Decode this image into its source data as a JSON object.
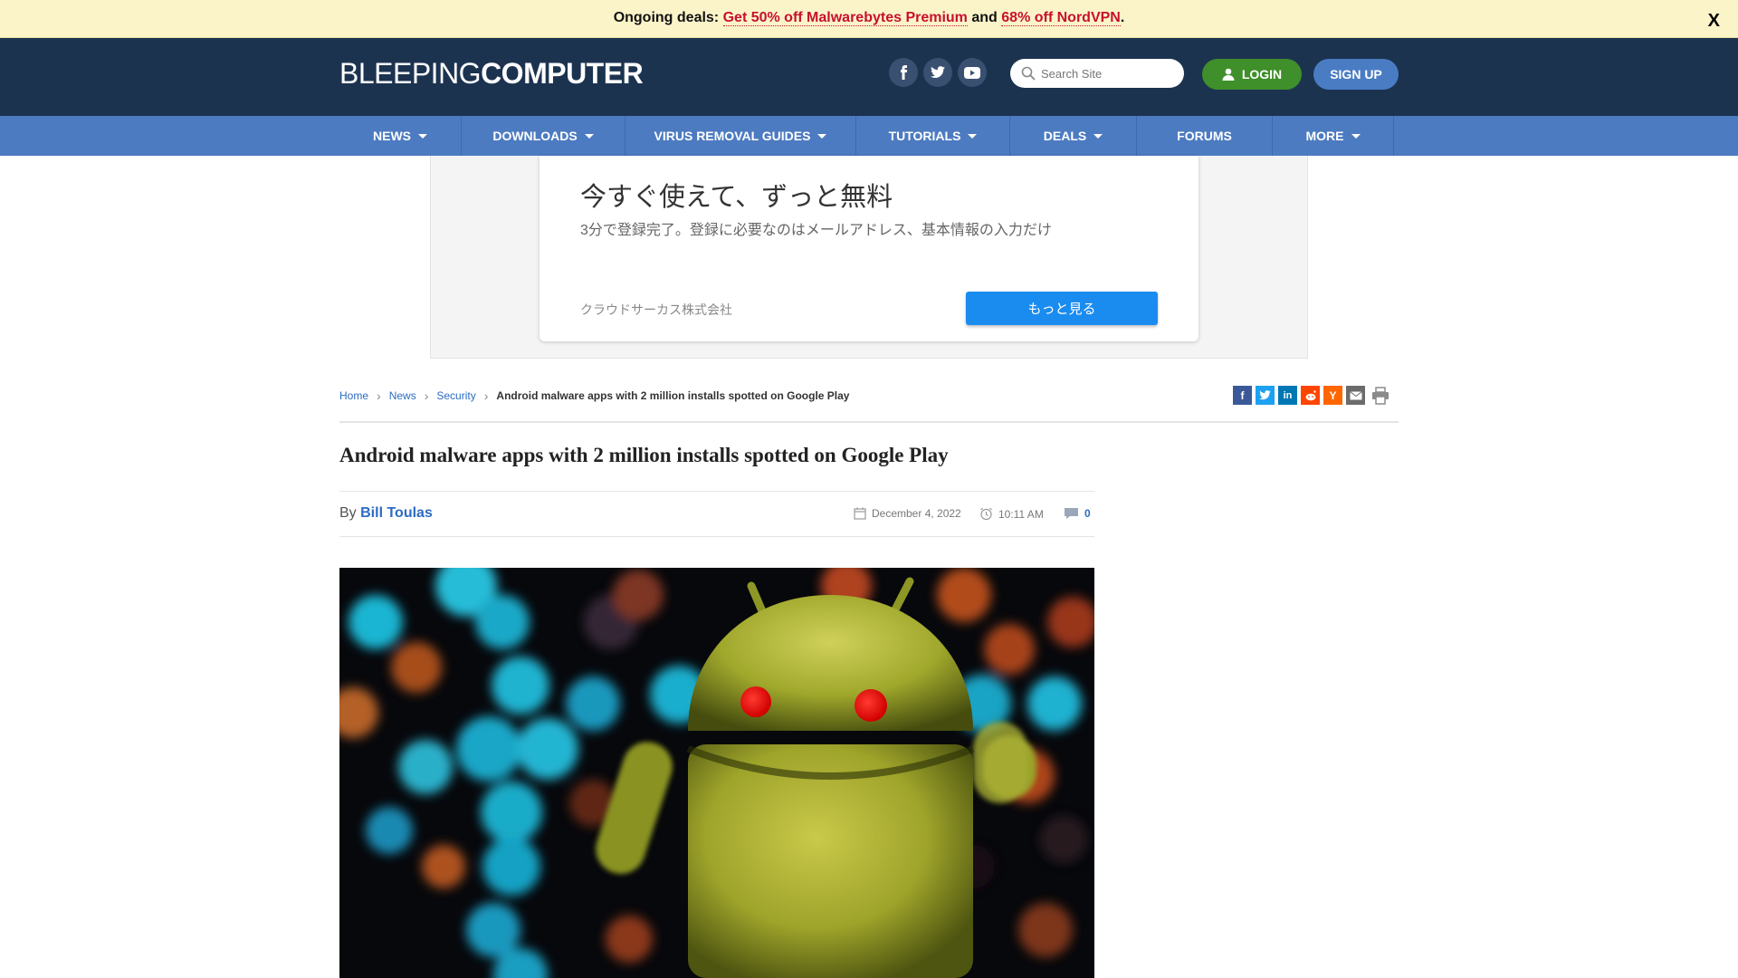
{
  "deals": {
    "prefix": "Ongoing deals:",
    "link1": "Get 50% off Malwarebytes Premium",
    "joiner": "and",
    "link2": "68% off NordVPN",
    "suffix": ".",
    "close": "X"
  },
  "header": {
    "logo_thin": "BLEEPING",
    "logo_bold": "COMPUTER",
    "social": [
      "facebook-icon",
      "twitter-icon",
      "youtube-icon"
    ],
    "search_placeholder": "Search Site",
    "login_label": "LOGIN",
    "signup_label": "SIGN UP"
  },
  "nav": {
    "items": [
      {
        "label": "NEWS",
        "dropdown": true
      },
      {
        "label": "DOWNLOADS",
        "dropdown": true
      },
      {
        "label": "VIRUS REMOVAL GUIDES",
        "dropdown": true
      },
      {
        "label": "TUTORIALS",
        "dropdown": true
      },
      {
        "label": "DEALS",
        "dropdown": true
      },
      {
        "label": "FORUMS",
        "dropdown": false
      },
      {
        "label": "MORE",
        "dropdown": true
      }
    ]
  },
  "ad": {
    "title": "今すぐ使えて、ずっと無料",
    "subtitle": "3分で登録完了。登録に必要なのはメールアドレス、基本情報の入力だけ",
    "company": "クラウドサーカス株式会社",
    "button": "もっと見る"
  },
  "breadcrumb": {
    "items": [
      "Home",
      "News",
      "Security"
    ],
    "current": "Android malware apps with 2 million installs spotted on Google Play"
  },
  "share": [
    "facebook-share-icon",
    "twitter-share-icon",
    "linkedin-share-icon",
    "reddit-share-icon",
    "hackernews-share-icon",
    "email-share-icon",
    "print-icon"
  ],
  "article": {
    "title": "Android malware apps with 2 million installs spotted on Google Play",
    "by": "By",
    "author": "Bill Toulas",
    "date": "December 4, 2022",
    "time": "10:11 AM",
    "comments": "0"
  },
  "colors": {
    "header_bg": "#1c3350",
    "nav_bg": "#4d7bc1",
    "login_bg": "#3f8f2a",
    "signup_bg": "#4a7cc4",
    "link": "#2c6cc4",
    "deal_link": "#c8102e"
  }
}
